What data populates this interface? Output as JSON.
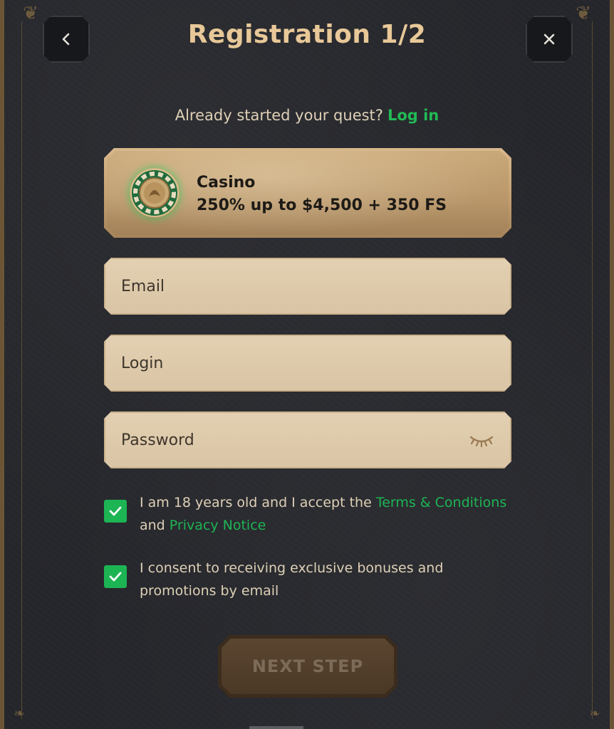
{
  "header": {
    "title": "Registration 1/2",
    "back_icon": "chevron-left-icon",
    "close_icon": "close-icon"
  },
  "login_prompt": {
    "text": "Already started your quest?",
    "link": "Log in"
  },
  "bonus": {
    "name": "Casino",
    "offer": "250% up to $4,500 + 350 FS",
    "icon": "casino-chip-icon"
  },
  "form": {
    "email_placeholder": "Email",
    "login_placeholder": "Login",
    "password_placeholder": "Password",
    "password_toggle_icon": "eye-closed-icon"
  },
  "checkboxes": {
    "terms": {
      "checked": true,
      "prefix": "I am 18 years old and I accept the",
      "terms_link": "Terms & Conditions",
      "middle": "and",
      "privacy_link": "Privacy Notice"
    },
    "consent": {
      "checked": true,
      "text": "I consent to receiving exclusive bonuses and promotions by email"
    }
  },
  "next_button": {
    "label": "NEXT STEP",
    "enabled": false
  },
  "colors": {
    "accent_green": "#1db454",
    "title_gold": "#e8c898",
    "field_bg": "#e3d0b2",
    "background": "#25262b"
  }
}
